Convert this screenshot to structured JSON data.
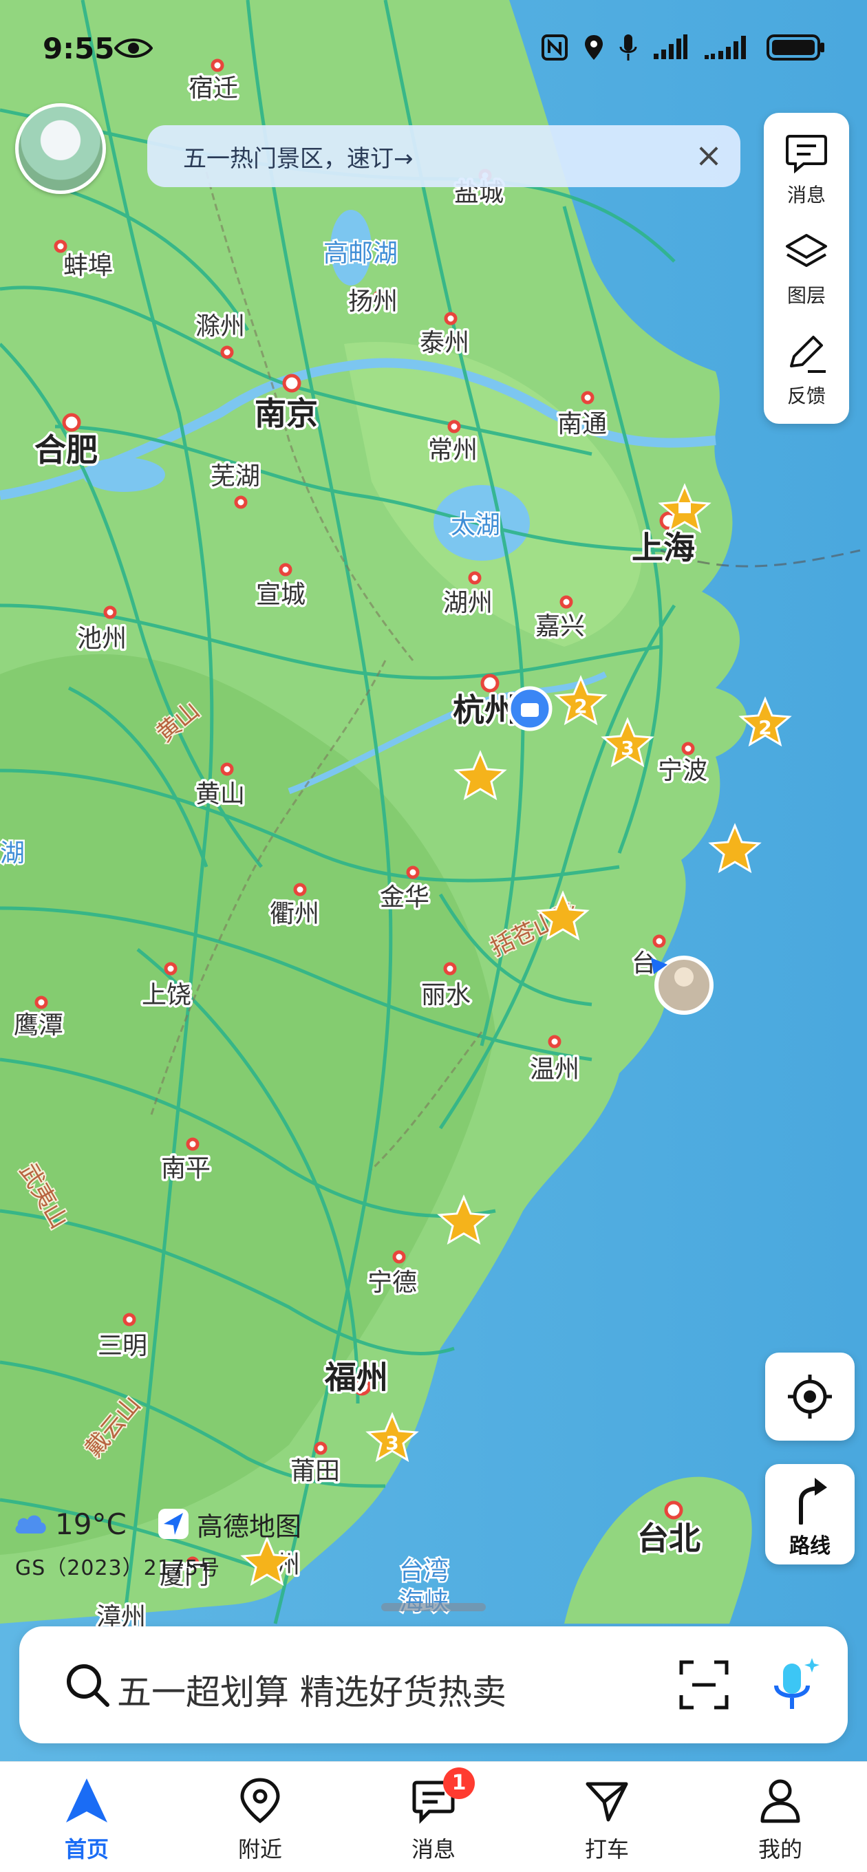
{
  "status_bar": {
    "time": "9:55"
  },
  "banner": {
    "text": "五一热门景区，速订→"
  },
  "right_panel": {
    "messages": "消息",
    "layers": "图层",
    "feedback": "反馈"
  },
  "map": {
    "cities": {
      "suqian": "宿迁",
      "yancheng": "盐城",
      "bengbu": "蚌埠",
      "chuzhou": "滁州",
      "yangzhou": "扬州",
      "taizhou_js": "泰州",
      "nanjing": "南京",
      "hefei": "合肥",
      "wuhu": "芜湖",
      "changzhou": "常州",
      "nantong": "南通",
      "shanghai": "上海",
      "xuancheng": "宣城",
      "huzhou": "湖州",
      "jiaxing": "嘉兴",
      "chizhou": "池州",
      "hangzhou": "杭州",
      "ningbo": "宁波",
      "huangshan": "黄山",
      "jinhua": "金华",
      "quzhou": "衢州",
      "taizhou_zj": "台",
      "lishui": "丽水",
      "shangrao": "上饶",
      "yingtan": "鹰潭",
      "wenzhou": "温州",
      "nanping": "南平",
      "ningde": "宁德",
      "sanming": "三明",
      "fuzhou": "福州",
      "putian": "莆田",
      "taibei": "台北",
      "zhangzhou": "漳州",
      "quanzhou": "州",
      "xiamen": "厦门"
    },
    "water": {
      "gaoyou_lake": "高邮湖",
      "tai_lake": "太湖",
      "taiwan_strait_1": "台湾",
      "taiwan_strait_2": "海峡",
      "lake_edge": "湖"
    },
    "ranges": {
      "huangshan": "黄山",
      "kuocang": "括苍山脉",
      "wuyi": "武夷山",
      "daiyun": "戴云山"
    },
    "cluster_counts": {
      "a": "2",
      "b": "3",
      "c": "2",
      "d": "3"
    }
  },
  "weather": {
    "text": "19°C"
  },
  "brand": {
    "text": "高德地图"
  },
  "license": {
    "text": "GS（2023）2175号"
  },
  "search": {
    "placeholder": "五一超划算 精选好货热卖"
  },
  "locate": {
    "label": ""
  },
  "route": {
    "label": "路线"
  },
  "tabbar": {
    "home": "首页",
    "nearby": "附近",
    "messages": "消息",
    "taxi": "打车",
    "mine": "我的",
    "messages_badge": "1"
  },
  "colors": {
    "accent": "#1a6cf5",
    "road": "#29b488",
    "land": "#8bd47a",
    "sea": "#6cc2ea",
    "star": "#f5b31b"
  }
}
